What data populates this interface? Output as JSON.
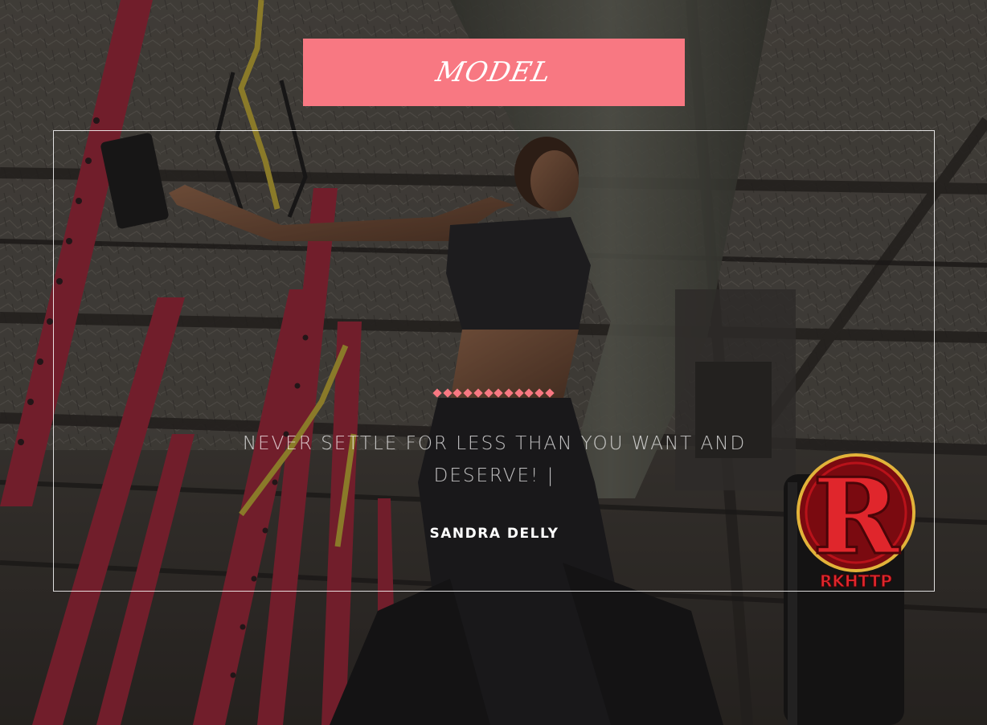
{
  "header": {
    "badge_label": "MODEL"
  },
  "testimonial": {
    "quote": "NEVER SETTLE FOR LESS THAN YOU WANT AND DESERVE! |",
    "author": "SANDRA DELLY"
  },
  "logo": {
    "text": "RKHTTP",
    "letter": "R"
  },
  "colors": {
    "accent": "#f87882",
    "text": "#ffffff",
    "logo_red": "#d41920",
    "logo_gold": "#e2b33a"
  },
  "icons": {
    "divider": "diamond-row-icon",
    "brand": "rkhttp-logo-icon"
  }
}
